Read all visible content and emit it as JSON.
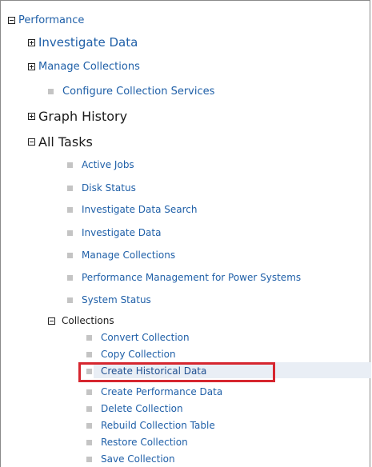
{
  "tree": {
    "root": {
      "label": "Performance",
      "state": "expanded"
    },
    "level1": [
      {
        "label": "Investigate Data",
        "state": "collapsed"
      },
      {
        "label": "Manage Collections",
        "state": "collapsed"
      },
      {
        "label": "Configure Collection Services",
        "state": "leaf"
      },
      {
        "label": "Graph History",
        "state": "collapsed"
      },
      {
        "label": "All Tasks",
        "state": "expanded"
      }
    ],
    "all_tasks": [
      "Active Jobs",
      "Disk Status",
      "Investigate Data Search",
      "Investigate Data",
      "Manage Collections",
      "Performance Management for Power Systems",
      "System Status"
    ],
    "collections_group": {
      "label": "Collections",
      "state": "expanded"
    },
    "collections_items": [
      "Convert Collection",
      "Copy Collection",
      "Create Historical Data",
      "Create Performance Data",
      "Delete Collection",
      "Rebuild Collection Table",
      "Restore Collection",
      "Save Collection"
    ],
    "selected_item": "Create Historical Data"
  },
  "colors": {
    "link": "#2060a8",
    "highlight_border": "#d6262f",
    "selection_background": "#e9eef5",
    "bullet": "#c4c4c4"
  }
}
